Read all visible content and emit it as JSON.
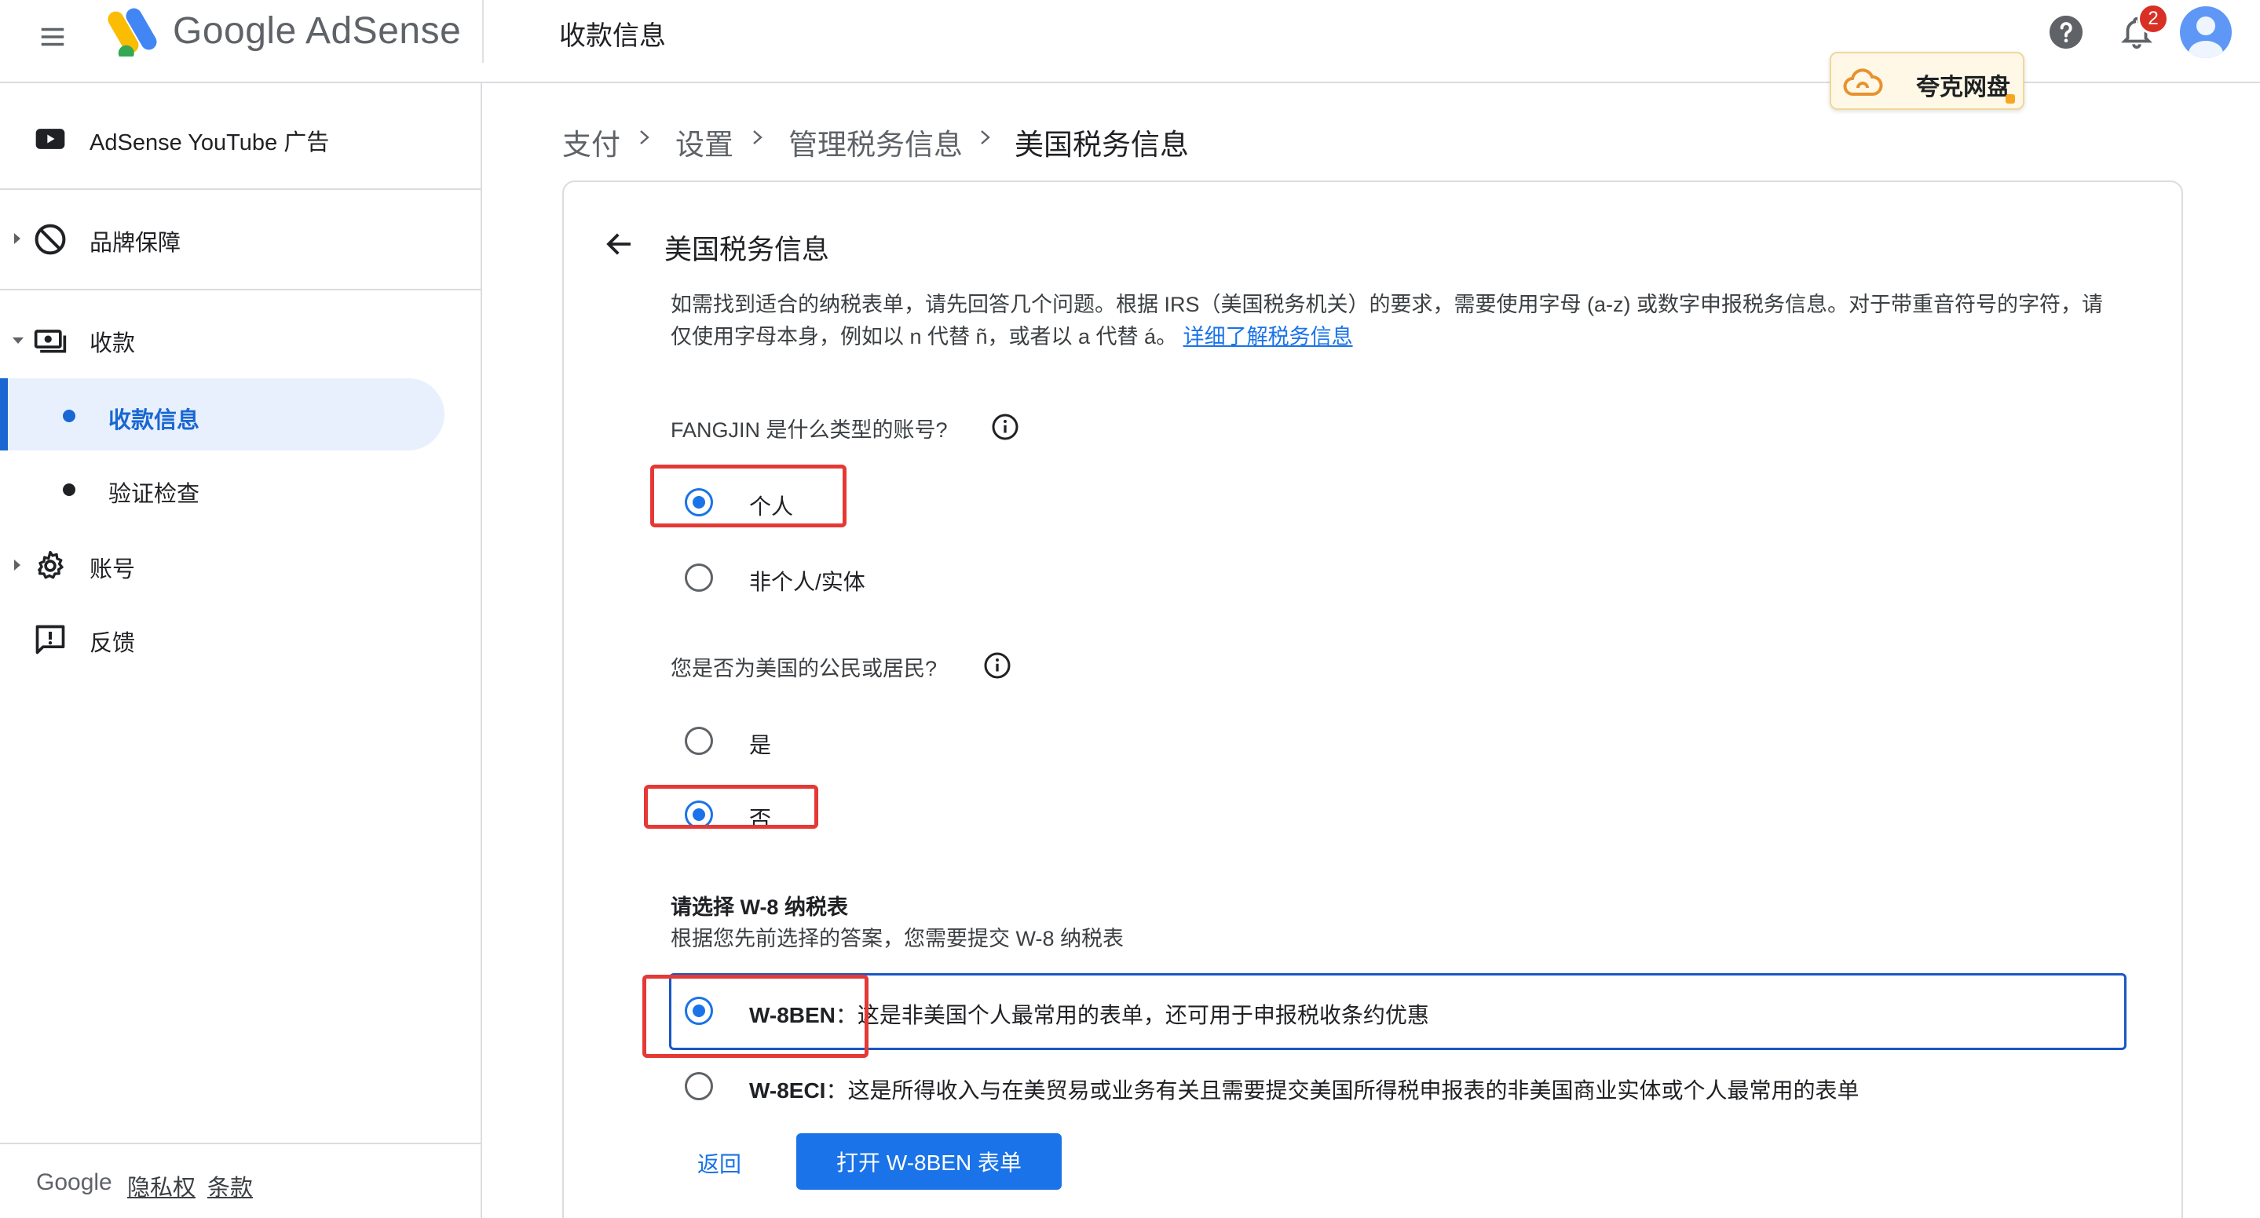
{
  "header": {
    "brand": "Google AdSense",
    "page_title": "收款信息",
    "notification_count": "2",
    "quark_label": "夸克网盘"
  },
  "sidebar": {
    "items": [
      {
        "label": "AdSense YouTube 广告",
        "icon": "youtube-icon"
      },
      {
        "label": "品牌保障",
        "icon": "block-icon"
      },
      {
        "label": "收款",
        "icon": "payments-icon"
      },
      {
        "label": "收款信息",
        "active": true
      },
      {
        "label": "验证检查"
      },
      {
        "label": "账号",
        "icon": "gear-icon"
      },
      {
        "label": "反馈",
        "icon": "feedback-icon"
      }
    ],
    "footer": {
      "google": "Google",
      "privacy": "隐私权",
      "terms": "条款"
    }
  },
  "breadcrumb": [
    "支付",
    "设置",
    "管理税务信息",
    "美国税务信息"
  ],
  "card": {
    "title": "美国税务信息",
    "desc_text": "如需找到适合的纳税表单，请先回答几个问题。根据 IRS（美国税务机关）的要求，需要使用字母 (a-z) 或数字申报税务信息。对于带重音符号的字符，请仅使用字母本身，例如以 n 代替 ñ，或者以 a 代替 á。",
    "desc_link": "详细了解税务信息",
    "q1": {
      "label": "FANGJIN 是什么类型的账号?",
      "options": [
        "个人",
        "非个人/实体"
      ],
      "selected": "个人"
    },
    "q2": {
      "label": "您是否为美国的公民或居民?",
      "options": [
        "是",
        "否"
      ],
      "selected": "否"
    },
    "form_section": {
      "title": "请选择 W-8 纳税表",
      "subtitle": "根据您先前选择的答案，您需要提交 W-8 纳税表",
      "options": [
        {
          "name": "W-8BEN",
          "desc": "：这是非美国个人最常用的表单，还可用于申报税收条约优惠"
        },
        {
          "name": "W-8ECI",
          "desc": "：这是所得收入与在美贸易或业务有关且需要提交美国所得税申报表的非美国商业实体或个人最常用的表单"
        }
      ],
      "selected": "W-8BEN"
    },
    "back_label": "返回",
    "open_label": "打开 W-8BEN 表单"
  },
  "colors": {
    "accent": "#1a73e8",
    "highlight": "#e53935",
    "active_bg": "#e8f0fe"
  }
}
